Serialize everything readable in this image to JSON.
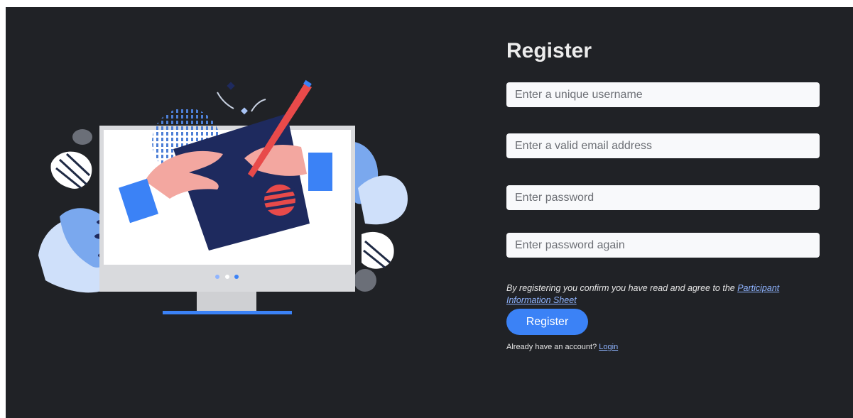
{
  "form": {
    "title": "Register",
    "username_placeholder": "Enter a unique username",
    "email_placeholder": "Enter a valid email address",
    "password_placeholder": "Enter password",
    "password_again_placeholder": "Enter password again",
    "terms_text": "By registering you confirm you have read and agree to the ",
    "terms_link": "Participant Information Sheet",
    "register_label": "Register",
    "login_prompt": "Already have an account? ",
    "login_link": "Login"
  },
  "colors": {
    "background": "#202226",
    "accent": "#3b82f6",
    "link": "#8fb4ff",
    "input_bg": "#f8f9fb"
  },
  "icons": [
    "monitor-illustration-icon"
  ]
}
